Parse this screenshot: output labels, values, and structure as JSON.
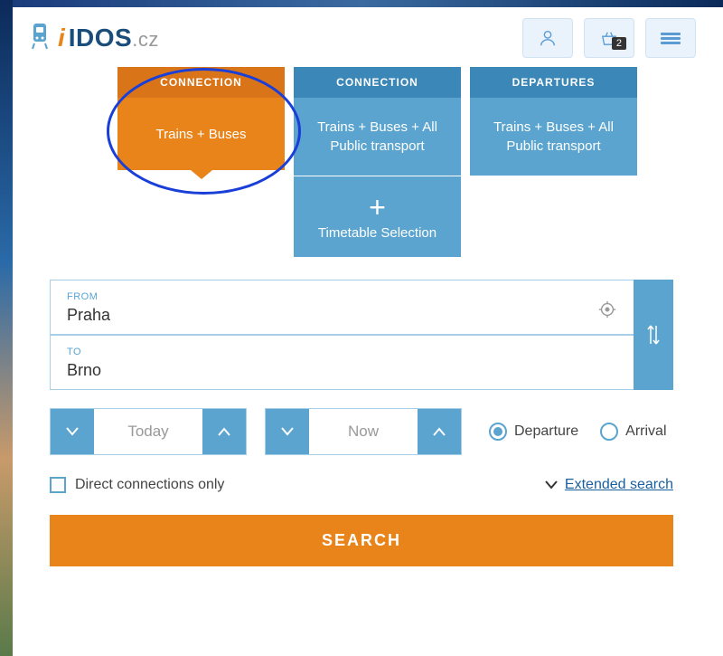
{
  "header": {
    "logo": {
      "idos": "IDOS",
      "cz": ".cz"
    },
    "cart_badge": "2"
  },
  "tabs": [
    {
      "head": "CONNECTION",
      "body": "Trains + Buses"
    },
    {
      "head": "CONNECTION",
      "body": "Trains + Buses + All Public transport",
      "extra_label": "Timetable Selection"
    },
    {
      "head": "DEPARTURES",
      "body": "Trains + Buses + All Public transport"
    }
  ],
  "form": {
    "from_label": "FROM",
    "from_value": "Praha",
    "to_label": "TO",
    "to_value": "Brno",
    "date_value": "Today",
    "time_value": "Now",
    "departure_label": "Departure",
    "arrival_label": "Arrival",
    "direct_label": "Direct connections only",
    "extended_label": "Extended search",
    "search_label": "SEARCH"
  }
}
